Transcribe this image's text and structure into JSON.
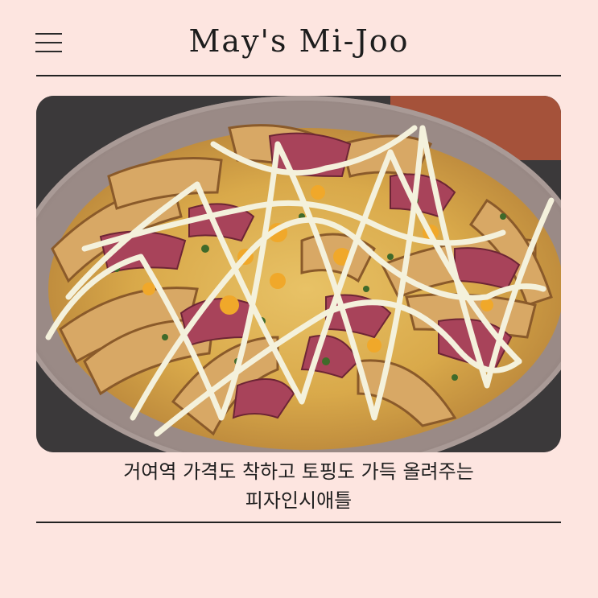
{
  "header": {
    "site_title": "May's Mi-Joo"
  },
  "post": {
    "caption_line1": "거여역 가격도 착하고 토핑도 가득 올려주는",
    "caption_line2": "피자인시애틀"
  },
  "icons": {
    "menu": "hamburger-menu-icon"
  },
  "colors": {
    "background": "#fde5e0",
    "rule": "#222222",
    "text": "#1e1e1e"
  }
}
